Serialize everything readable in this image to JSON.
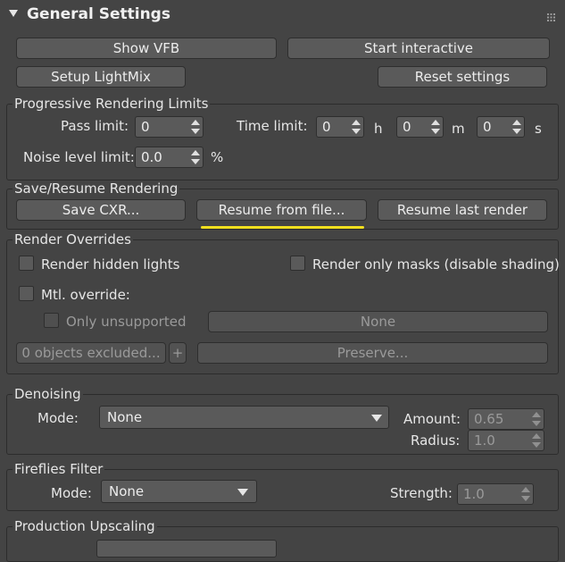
{
  "header": {
    "title": "General Settings"
  },
  "top_buttons": {
    "show_vfb": "Show VFB",
    "start_interactive": "Start interactive",
    "setup_lightmix": "Setup LightMix",
    "reset_settings": "Reset settings"
  },
  "progressive": {
    "title": "Progressive Rendering Limits",
    "pass_label": "Pass limit:",
    "pass_value": "0",
    "time_label": "Time limit:",
    "h_value": "0",
    "h_unit": "h",
    "m_value": "0",
    "m_unit": "m",
    "s_value": "0",
    "s_unit": "s",
    "noise_label": "Noise level limit:",
    "noise_value": "0.0",
    "noise_unit": "%"
  },
  "save_resume": {
    "title": "Save/Resume Rendering",
    "save_cxr": "Save CXR...",
    "resume_from_file": "Resume from file...",
    "resume_last": "Resume last render"
  },
  "overrides": {
    "title": "Render Overrides",
    "hidden_lights": "Render hidden lights",
    "only_masks": "Render only masks (disable shading)",
    "mtl_override": "Mtl. override:",
    "only_unsupported": "Only unsupported",
    "none_button": "None",
    "objects_excluded": "0 objects excluded...",
    "plus": "+",
    "preserve": "Preserve..."
  },
  "denoising": {
    "title": "Denoising",
    "mode_label": "Mode:",
    "mode_value": "None",
    "amount_label": "Amount:",
    "amount_value": "0.65",
    "radius_label": "Radius:",
    "radius_value": "1.0"
  },
  "fireflies": {
    "title": "Fireflies Filter",
    "mode_label": "Mode:",
    "mode_value": "None",
    "strength_label": "Strength:",
    "strength_value": "1.0"
  },
  "upscaling": {
    "title": "Production Upscaling"
  },
  "colors": {
    "background": "#444444",
    "highlight": "#f2df1e"
  }
}
